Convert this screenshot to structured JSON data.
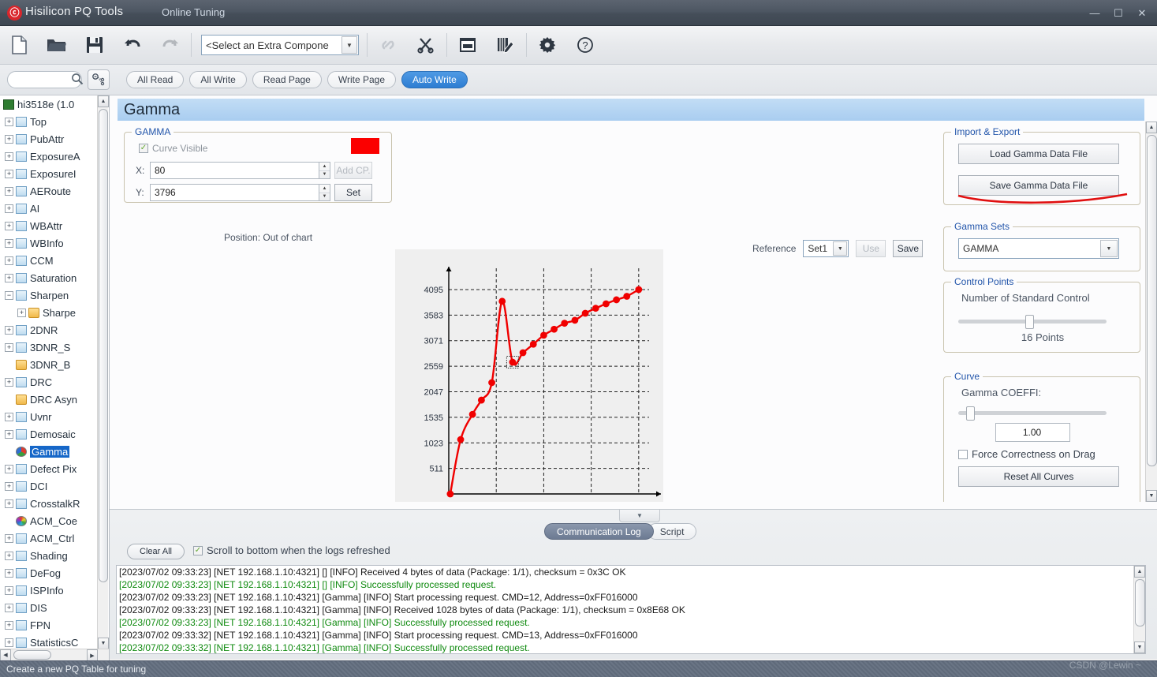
{
  "window": {
    "app_title": "Hisilicon PQ Tools",
    "tab": "Online Tuning",
    "logo_glyph": "ⓒ",
    "minimize": "—",
    "maximize": "☐",
    "close": "✕"
  },
  "toolbar": {
    "icons": [
      {
        "name": "new-file-icon",
        "glyph": "🗋",
        "disabled": false
      },
      {
        "name": "open-folder-icon",
        "glyph": "📁",
        "disabled": false
      },
      {
        "name": "save-icon",
        "glyph": "💾",
        "disabled": false
      },
      {
        "name": "undo-icon",
        "glyph": "↶",
        "disabled": false
      },
      {
        "name": "redo-icon",
        "glyph": "↷",
        "disabled": true
      }
    ],
    "component_select": "<Select an Extra Compone",
    "icons2": [
      {
        "name": "link-icon",
        "glyph": "🔗",
        "disabled": true
      },
      {
        "name": "cut-icon",
        "glyph": "✂",
        "disabled": false
      },
      {
        "name": "window-icon",
        "glyph": "▣",
        "disabled": false
      },
      {
        "name": "notepad-edit-icon",
        "glyph": "📝",
        "disabled": false
      },
      {
        "name": "gear-icon",
        "glyph": "⚙",
        "disabled": false
      },
      {
        "name": "help-icon",
        "glyph": "?",
        "disabled": false
      }
    ]
  },
  "subbar": {
    "search_value": "",
    "search_placeholder": "",
    "buttons": [
      {
        "label": "All Read",
        "active": false
      },
      {
        "label": "All Write",
        "active": false
      },
      {
        "label": "Read Page",
        "active": false
      },
      {
        "label": "Write Page",
        "active": false
      },
      {
        "label": "Auto Write",
        "active": true
      }
    ]
  },
  "tree": {
    "root": "hi3518e (1.0",
    "items": [
      {
        "label": "Top",
        "icon": "table",
        "expandable": true,
        "indent": 0
      },
      {
        "label": "PubAttr",
        "icon": "table",
        "expandable": true,
        "indent": 0
      },
      {
        "label": "ExposureA",
        "icon": "table",
        "expandable": true,
        "indent": 0
      },
      {
        "label": "ExposureI",
        "icon": "table",
        "expandable": true,
        "indent": 0
      },
      {
        "label": "AERoute",
        "icon": "table",
        "expandable": true,
        "indent": 0
      },
      {
        "label": "AI",
        "icon": "table",
        "expandable": true,
        "indent": 0
      },
      {
        "label": "WBAttr",
        "icon": "table",
        "expandable": true,
        "indent": 0
      },
      {
        "label": "WBInfo",
        "icon": "table",
        "expandable": true,
        "indent": 0
      },
      {
        "label": "CCM",
        "icon": "table",
        "expandable": true,
        "indent": 0
      },
      {
        "label": "Saturation",
        "icon": "table",
        "expandable": true,
        "indent": 0
      },
      {
        "label": "Sharpen",
        "icon": "table",
        "expandable": true,
        "expanded": true,
        "indent": 0
      },
      {
        "label": "Sharpe",
        "icon": "folder",
        "expandable": true,
        "indent": 1
      },
      {
        "label": "2DNR",
        "icon": "table",
        "expandable": true,
        "indent": 0
      },
      {
        "label": "3DNR_S",
        "icon": "table",
        "expandable": true,
        "indent": 0
      },
      {
        "label": "3DNR_B",
        "icon": "folder",
        "expandable": false,
        "indent": 0
      },
      {
        "label": "DRC",
        "icon": "table",
        "expandable": true,
        "indent": 0
      },
      {
        "label": "DRC Asyn",
        "icon": "folder",
        "expandable": false,
        "indent": 0
      },
      {
        "label": "Uvnr",
        "icon": "table",
        "expandable": true,
        "indent": 0
      },
      {
        "label": "Demosaic",
        "icon": "table",
        "expandable": true,
        "indent": 0
      },
      {
        "label": "Gamma",
        "icon": "pie",
        "expandable": false,
        "indent": 0,
        "selected": true
      },
      {
        "label": "Defect Pix",
        "icon": "table",
        "expandable": true,
        "indent": 0
      },
      {
        "label": "DCI",
        "icon": "table",
        "expandable": true,
        "indent": 0
      },
      {
        "label": "CrosstalkR",
        "icon": "table",
        "expandable": true,
        "indent": 0
      },
      {
        "label": "ACM_Coe",
        "icon": "wheel",
        "expandable": false,
        "indent": 0
      },
      {
        "label": "ACM_Ctrl",
        "icon": "table",
        "expandable": true,
        "indent": 0
      },
      {
        "label": "Shading",
        "icon": "table",
        "expandable": true,
        "indent": 0
      },
      {
        "label": "DeFog",
        "icon": "table",
        "expandable": true,
        "indent": 0
      },
      {
        "label": "ISPInfo",
        "icon": "table",
        "expandable": true,
        "indent": 0
      },
      {
        "label": "DIS",
        "icon": "table",
        "expandable": true,
        "indent": 0
      },
      {
        "label": "FPN",
        "icon": "table",
        "expandable": true,
        "indent": 0
      },
      {
        "label": "StatisticsC",
        "icon": "table",
        "expandable": true,
        "indent": 0
      }
    ]
  },
  "page": {
    "title": "Gamma"
  },
  "gamma_panel": {
    "group_title": "GAMMA",
    "curve_visible_label": "Curve Visible",
    "curve_visible_checked": true,
    "curve_color": "#fb0000",
    "x_label": "X:",
    "x_value": "80",
    "y_label": "Y:",
    "y_value": "3796",
    "add_cp_label": "Add CP.",
    "set_label": "Set",
    "position_label": "Position: Out of chart"
  },
  "reference": {
    "label": "Reference",
    "set_value": "Set1",
    "use_label": "Use",
    "save_label": "Save"
  },
  "import_export": {
    "group_title": "Import & Export",
    "load_label": "Load Gamma Data File",
    "save_label": "Save Gamma Data File"
  },
  "gamma_sets": {
    "group_title": "Gamma Sets",
    "value": "GAMMA"
  },
  "control_points": {
    "group_title": "Control Points",
    "caption": "Number of Standard Control",
    "value_label": "16 Points",
    "slider_pct": 48
  },
  "curve": {
    "group_title": "Curve",
    "coeffi_label": "Gamma COEFFI:",
    "coeffi_value": "1.00",
    "slider_pct": 8,
    "force_label": "Force Correctness on Drag",
    "force_checked": false,
    "reset_label": "Reset All Curves"
  },
  "dock": {
    "tabs": [
      {
        "label": "Communication Log",
        "active": true
      },
      {
        "label": "Script",
        "active": false
      }
    ],
    "clear_label": "Clear All",
    "scroll_label": "Scroll to bottom when the logs refreshed",
    "scroll_checked": true,
    "log_lines": [
      {
        "text": "[2023/07/02 09:33:23] [NET 192.168.1.10:4321] [] [INFO] Received 4 bytes of data (Package: 1/1), checksum = 0x3C OK",
        "type": "info"
      },
      {
        "text": "[2023/07/02 09:33:23] [NET 192.168.1.10:4321] [] [INFO] Successfully processed request.",
        "type": "ok"
      },
      {
        "text": "[2023/07/02 09:33:23] [NET 192.168.1.10:4321] [Gamma] [INFO] Start processing request. CMD=12, Address=0xFF016000",
        "type": "info"
      },
      {
        "text": "[2023/07/02 09:33:23] [NET 192.168.1.10:4321] [Gamma] [INFO] Received 1028 bytes of data (Package: 1/1), checksum = 0x8E68 OK",
        "type": "info"
      },
      {
        "text": "[2023/07/02 09:33:23] [NET 192.168.1.10:4321] [Gamma] [INFO] Successfully processed request.",
        "type": "ok"
      },
      {
        "text": "[2023/07/02 09:33:32] [NET 192.168.1.10:4321] [Gamma] [INFO] Start processing request. CMD=13, Address=0xFF016000",
        "type": "info"
      },
      {
        "text": "[2023/07/02 09:33:32] [NET 192.168.1.10:4321] [Gamma] [INFO] Successfully processed request.",
        "type": "ok"
      }
    ]
  },
  "statusbar": {
    "text": "Create a new PQ Table for tuning",
    "watermark": "CSDN @Lewin ~"
  },
  "chart_data": {
    "type": "line",
    "title": "",
    "xlabel": "",
    "ylabel": "",
    "xlim": [
      0,
      270
    ],
    "ylim": [
      0,
      4300
    ],
    "xticks": [
      0,
      64,
      128,
      192,
      256
    ],
    "yticks": [
      511,
      1023,
      1535,
      2047,
      2559,
      3071,
      3583,
      4095
    ],
    "grid": true,
    "legend": false,
    "series_color": "#f00000",
    "selected_point_index": 6,
    "x": [
      2,
      16,
      32,
      44,
      58,
      72,
      86,
      100,
      114,
      128,
      142,
      156,
      170,
      184,
      198,
      212,
      226,
      240,
      256
    ],
    "y": [
      0,
      1090,
      1595,
      1880,
      2230,
      3860,
      2640,
      2830,
      3000,
      3180,
      3300,
      3420,
      3480,
      3620,
      3720,
      3810,
      3890,
      3960,
      4095
    ]
  }
}
